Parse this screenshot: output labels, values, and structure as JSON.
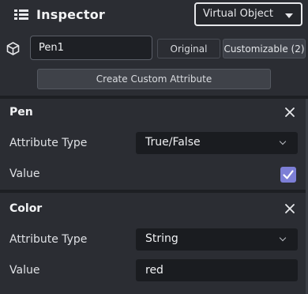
{
  "header": {
    "title": "Inspector",
    "mode_value": "Virtual Object"
  },
  "object": {
    "name_value": "Pen1",
    "tab_original": "Original",
    "tab_customizable": "Customizable (2)",
    "create_button": "Create Custom Attribute"
  },
  "sections": [
    {
      "title": "Pen",
      "type_label": "Attribute Type",
      "type_value": "True/False",
      "value_label": "Value",
      "value_checked": true
    },
    {
      "title": "Color",
      "type_label": "Attribute Type",
      "type_value": "String",
      "value_label": "Value",
      "value_text": "red"
    }
  ],
  "colors": {
    "background": "#2b2d33",
    "accent": "#7d7fd6",
    "field": "#1a1c20"
  },
  "icons": {
    "menu": "hamburger-icon",
    "object": "cube-icon",
    "close": "close-icon",
    "chevron": "chevron-down-icon",
    "check": "check-icon"
  }
}
